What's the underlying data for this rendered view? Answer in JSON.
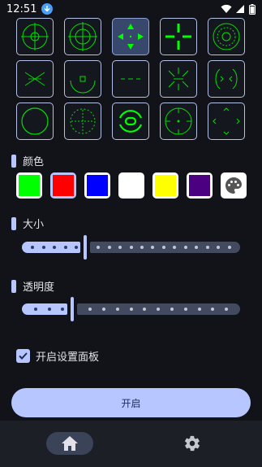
{
  "status_bar": {
    "time": "12:51",
    "download_icon": "download-icon",
    "wifi_icon": "wifi-icon",
    "signal_icon": "signal-icon",
    "battery_icon": "battery-icon"
  },
  "crosshair_styles": {
    "selected_index": 2,
    "items": [
      {
        "name": "crosshair-circle-target"
      },
      {
        "name": "crosshair-double-circle"
      },
      {
        "name": "crosshair-arrows"
      },
      {
        "name": "crosshair-bold-cross"
      },
      {
        "name": "crosshair-ring-dotted"
      },
      {
        "name": "crosshair-x-thin"
      },
      {
        "name": "crosshair-bracket-square"
      },
      {
        "name": "crosshair-dash-dot"
      },
      {
        "name": "crosshair-chevron-corners"
      },
      {
        "name": "crosshair-curly-brackets"
      },
      {
        "name": "crosshair-plain-circle"
      },
      {
        "name": "crosshair-dotted-circle"
      },
      {
        "name": "crosshair-arc-circle"
      },
      {
        "name": "crosshair-tick-circle"
      },
      {
        "name": "crosshair-chevrons-inward"
      }
    ]
  },
  "color_section": {
    "title": "颜色",
    "swatches": [
      {
        "name": "green",
        "color": "#00ff00"
      },
      {
        "name": "red",
        "color": "#ff0000"
      },
      {
        "name": "blue",
        "color": "#0000ff"
      },
      {
        "name": "white",
        "color": "#ffffff"
      },
      {
        "name": "yellow",
        "color": "#ffff00"
      },
      {
        "name": "purple",
        "color": "#4b0082"
      }
    ],
    "selected_index": 1,
    "custom_icon": "palette-icon"
  },
  "size_section": {
    "title": "大小",
    "value": 0.29,
    "steps": 21
  },
  "opacity_section": {
    "title": "透明度",
    "value": 0.23,
    "steps": 17
  },
  "settings_panel_checkbox": {
    "label": "开启设置面板",
    "checked": true
  },
  "primary_button": {
    "label": "开启"
  },
  "bottom_nav": {
    "items": [
      {
        "icon": "home-icon",
        "active": true
      },
      {
        "icon": "gear-icon",
        "active": false
      }
    ]
  },
  "colors": {
    "accent": "#b7c6ff",
    "background": "#121318",
    "crosshair": "#00ff00"
  }
}
